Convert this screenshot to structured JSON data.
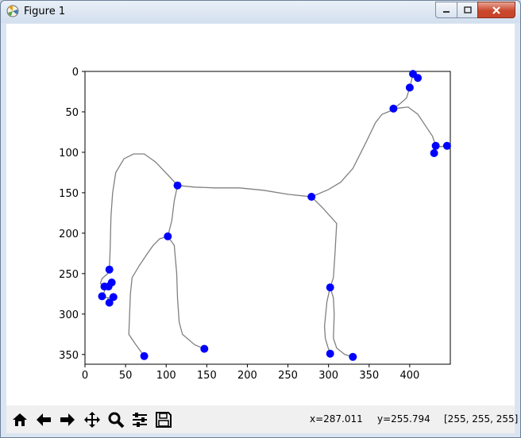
{
  "window": {
    "title": "Figure 1",
    "minimize_icon": "minimize-icon",
    "maximize_icon": "maximize-icon",
    "close_icon": "close-icon"
  },
  "toolbar": {
    "tools": [
      {
        "name": "home",
        "icon": "home-icon"
      },
      {
        "name": "back",
        "icon": "back-arrow-icon"
      },
      {
        "name": "forward",
        "icon": "forward-arrow-icon"
      },
      {
        "name": "pan",
        "icon": "move-icon"
      },
      {
        "name": "zoom",
        "icon": "magnifier-icon"
      },
      {
        "name": "configure-subplots",
        "icon": "sliders-icon"
      },
      {
        "name": "save",
        "icon": "floppy-disk-icon"
      }
    ]
  },
  "status": {
    "x": "x=287.011",
    "y": "y=255.794",
    "rgb": "[255, 255, 255]"
  },
  "chart_data": {
    "type": "line",
    "xlabel": "",
    "ylabel": "",
    "xlim": [
      0,
      450
    ],
    "ylim": [
      362,
      0
    ],
    "x_ticks": [
      "0",
      "50",
      "100",
      "150",
      "200",
      "250",
      "300",
      "350",
      "400"
    ],
    "y_ticks": [
      "0",
      "50",
      "100",
      "150",
      "200",
      "250",
      "300",
      "350"
    ],
    "grid": false,
    "line_color": "#808080",
    "point_color": "#0000ff",
    "paths": [
      [
        [
          30,
          245
        ],
        [
          31,
          220
        ],
        [
          32,
          180
        ],
        [
          34,
          150
        ],
        [
          38,
          125
        ],
        [
          48,
          108
        ],
        [
          60,
          102
        ],
        [
          73,
          102
        ],
        [
          87,
          112
        ],
        [
          104,
          130
        ],
        [
          114,
          141
        ]
      ],
      [
        [
          114,
          141
        ],
        [
          135,
          143
        ],
        [
          160,
          144
        ],
        [
          190,
          144
        ],
        [
          220,
          147
        ],
        [
          250,
          152
        ],
        [
          279,
          155
        ]
      ],
      [
        [
          279,
          155
        ],
        [
          300,
          146
        ],
        [
          315,
          137
        ],
        [
          330,
          120
        ],
        [
          345,
          90
        ],
        [
          358,
          63
        ],
        [
          366,
          53
        ],
        [
          376,
          49
        ],
        [
          380,
          46
        ]
      ],
      [
        [
          380,
          46
        ],
        [
          388,
          40
        ],
        [
          396,
          33
        ],
        [
          400,
          20
        ]
      ],
      [
        [
          400,
          20
        ],
        [
          402,
          12
        ],
        [
          404,
          3
        ],
        [
          410,
          8
        ]
      ],
      [
        [
          380,
          46
        ],
        [
          398,
          44
        ],
        [
          410,
          53
        ],
        [
          420,
          68
        ],
        [
          428,
          80
        ],
        [
          432,
          92
        ]
      ],
      [
        [
          432,
          92
        ],
        [
          438,
          93
        ],
        [
          446,
          92
        ]
      ],
      [
        [
          432,
          92
        ],
        [
          429,
          98
        ],
        [
          430,
          101
        ]
      ],
      [
        [
          114,
          141
        ],
        [
          110,
          160
        ],
        [
          107,
          184
        ],
        [
          102,
          204
        ]
      ],
      [
        [
          102,
          204
        ],
        [
          92,
          207
        ],
        [
          84,
          215
        ],
        [
          77,
          225
        ],
        [
          67,
          240
        ],
        [
          58,
          255
        ],
        [
          56,
          275
        ],
        [
          55,
          300
        ],
        [
          54,
          325
        ],
        [
          62,
          337
        ],
        [
          70,
          348
        ],
        [
          73,
          352
        ]
      ],
      [
        [
          102,
          204
        ],
        [
          110,
          215
        ],
        [
          113,
          250
        ],
        [
          114,
          280
        ],
        [
          116,
          310
        ],
        [
          120,
          325
        ],
        [
          135,
          338
        ],
        [
          147,
          343
        ]
      ],
      [
        [
          279,
          155
        ],
        [
          292,
          168
        ],
        [
          310,
          188
        ],
        [
          308,
          225
        ],
        [
          306,
          255
        ],
        [
          302,
          267
        ]
      ],
      [
        [
          302,
          267
        ],
        [
          298,
          285
        ],
        [
          295,
          315
        ],
        [
          296,
          330
        ],
        [
          299,
          340
        ],
        [
          302,
          349
        ]
      ],
      [
        [
          302,
          267
        ],
        [
          306,
          280
        ],
        [
          307,
          300
        ],
        [
          306,
          330
        ],
        [
          310,
          342
        ],
        [
          320,
          350
        ],
        [
          330,
          353
        ]
      ],
      [
        [
          30,
          245
        ],
        [
          28,
          250
        ],
        [
          21,
          256
        ],
        [
          19,
          262
        ],
        [
          24,
          266
        ]
      ],
      [
        [
          24,
          266
        ],
        [
          30,
          264
        ],
        [
          33,
          261
        ]
      ],
      [
        [
          24,
          266
        ],
        [
          24,
          272
        ],
        [
          21,
          278
        ]
      ],
      [
        [
          21,
          278
        ],
        [
          28,
          280
        ],
        [
          35,
          279
        ]
      ],
      [
        [
          28,
          280
        ],
        [
          30,
          286
        ]
      ]
    ],
    "points": [
      [
        404,
        3
      ],
      [
        410,
        8
      ],
      [
        400,
        20
      ],
      [
        380,
        46
      ],
      [
        446,
        92
      ],
      [
        432,
        92
      ],
      [
        430,
        101
      ],
      [
        114,
        141
      ],
      [
        279,
        155
      ],
      [
        102,
        204
      ],
      [
        30,
        245
      ],
      [
        33,
        261
      ],
      [
        24,
        266
      ],
      [
        29,
        266
      ],
      [
        35,
        279
      ],
      [
        21,
        278
      ],
      [
        30,
        286
      ],
      [
        302,
        267
      ],
      [
        147,
        343
      ],
      [
        302,
        349
      ],
      [
        73,
        352
      ],
      [
        330,
        353
      ]
    ]
  }
}
